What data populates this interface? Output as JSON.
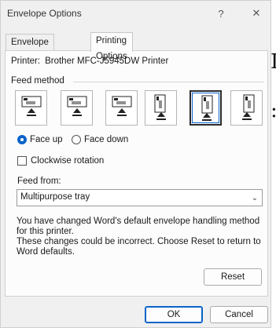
{
  "dialog": {
    "title": "Envelope Options",
    "help_glyph": "?",
    "close_glyph": "✕"
  },
  "tabs": [
    {
      "label": "Envelope Options",
      "active": false
    },
    {
      "label": "Printing Options",
      "active": true
    }
  ],
  "printer": {
    "label": "Printer:",
    "name": "Brother MFC-J5945DW Printer"
  },
  "feed_method": {
    "label": "Feed method",
    "options": [
      {
        "name": "horizontal-center",
        "selected": false
      },
      {
        "name": "horizontal-left",
        "selected": false
      },
      {
        "name": "horizontal-right",
        "selected": false
      },
      {
        "name": "vertical-center",
        "selected": false
      },
      {
        "name": "vertical-left",
        "selected": true
      },
      {
        "name": "vertical-right",
        "selected": false
      }
    ],
    "face_up_label": "Face up",
    "face_down_label": "Face down",
    "face_up_checked": true,
    "clockwise_label": "Clockwise rotation",
    "clockwise_checked": false
  },
  "feed_from": {
    "label": "Feed from:",
    "value": "Multipurpose tray"
  },
  "message": {
    "line1": "You have changed Word's default envelope handling method for this printer.",
    "line2": "These changes could be incorrect. Choose Reset to return to Word defaults."
  },
  "buttons": {
    "reset": "Reset",
    "ok": "OK",
    "cancel": "Cancel"
  },
  "colors": {
    "accent": "#0a64c8",
    "dialog_bg": "#f0f0f0",
    "panel_bg": "#fcfcfc"
  }
}
